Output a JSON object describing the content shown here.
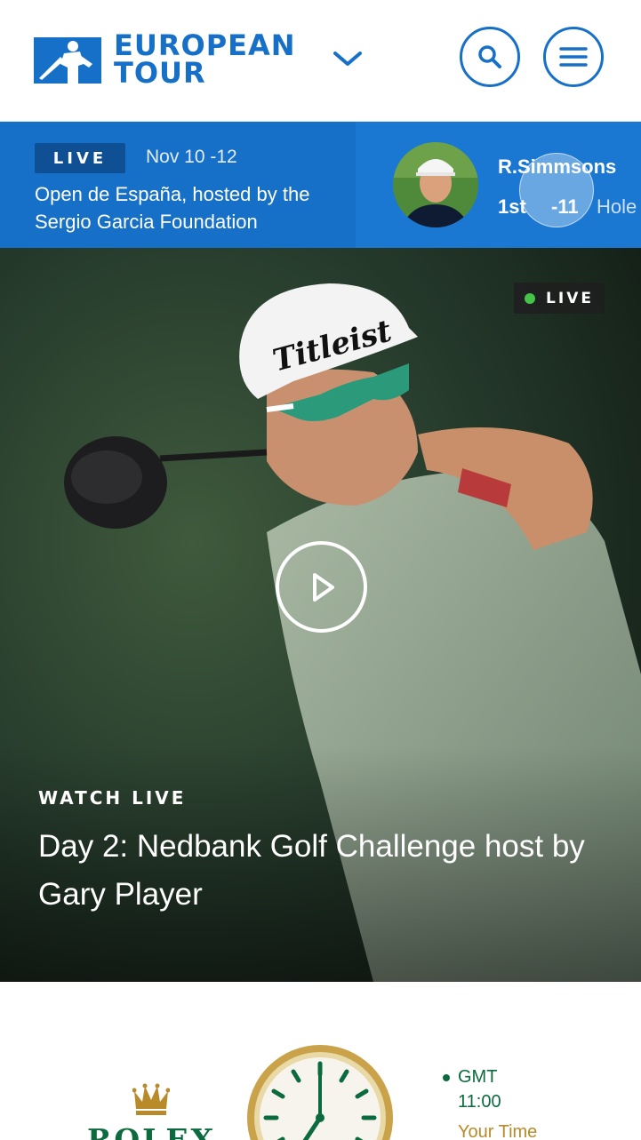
{
  "header": {
    "logo_line1": "EUROPEAN",
    "logo_line2": "TOUR",
    "brand_color": "#1670c7"
  },
  "live_bar": {
    "badge": "LIVE",
    "date": "Nov 10 -12",
    "event": "Open de España, hosted by the Sergio Garcia Foundation",
    "player": {
      "name": "R.Simmsons",
      "position": "1st",
      "score": "-11",
      "hole_label": "Hole"
    }
  },
  "hero": {
    "live_badge": "LIVE",
    "kicker": "WATCH LIVE",
    "title": "Day 2: Nedbank Golf Challenge host by Gary Player",
    "live_dot_color": "#44c24a"
  },
  "rolex": {
    "brand": "ROLEX",
    "gmt_label": "GMT",
    "gmt_time": "11:00",
    "your_time_label": "Your Time",
    "brand_color": "#0c6b3e"
  },
  "icons": [
    "menu-icon",
    "search-icon",
    "chevron-down-icon",
    "play-icon",
    "crown-icon"
  ]
}
